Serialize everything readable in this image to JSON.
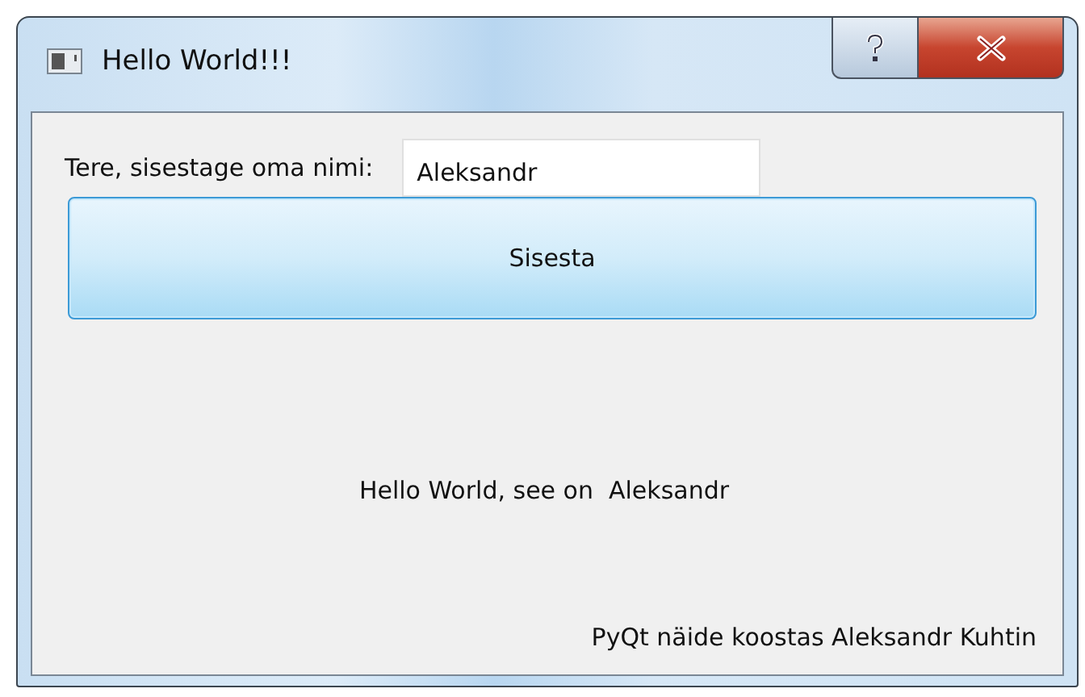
{
  "window": {
    "title": "Hello World!!!"
  },
  "form": {
    "label": "Tere, sisestage oma nimi:",
    "name_field": {
      "value": "Aleksandr"
    }
  },
  "submit_button": {
    "label": "Sisesta"
  },
  "greeting": "Hello World, see on  Aleksandr",
  "credit": "PyQt näide koostas Aleksandr Kuhtin"
}
